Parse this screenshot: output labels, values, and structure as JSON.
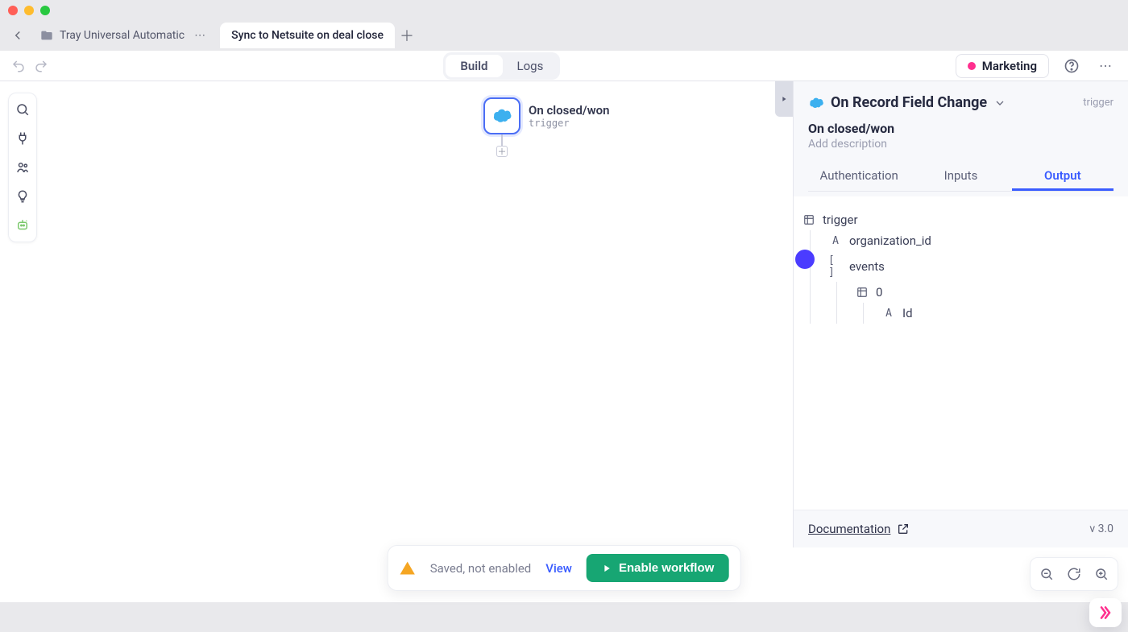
{
  "tabs": {
    "inactive_label": "Tray Universal Automatic",
    "active_label": "Sync to Netsuite on deal close"
  },
  "toolbar": {
    "build": "Build",
    "logs": "Logs",
    "environment": "Marketing"
  },
  "canvas": {
    "node_title": "On closed/won",
    "node_subtitle": "trigger"
  },
  "right_panel": {
    "connector_title": "On Record Field Change",
    "kind": "trigger",
    "step_name": "On closed/won",
    "description_placeholder": "Add description",
    "tabs": {
      "auth": "Authentication",
      "inputs": "Inputs",
      "output": "Output"
    },
    "output_tree": {
      "root": "trigger",
      "organization_id": "organization_id",
      "events": "events",
      "index0": "0",
      "id": "Id"
    },
    "doc_label": "Documentation",
    "version": "v 3.0"
  },
  "status": {
    "text": "Saved, not enabled",
    "view": "View",
    "enable": "Enable workflow"
  }
}
